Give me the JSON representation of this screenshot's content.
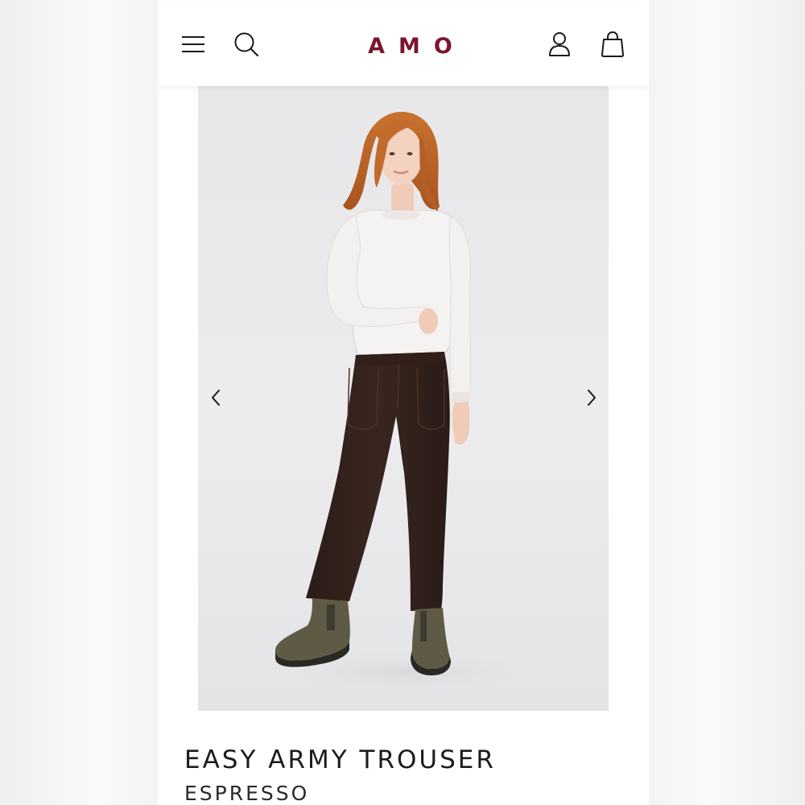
{
  "header": {
    "logo": "AMO",
    "logo_color": "#7a1530",
    "icons": {
      "menu": "hamburger-menu-icon",
      "search": "search-icon",
      "account": "account-icon",
      "cart": "shopping-bag-icon"
    }
  },
  "product": {
    "name": "EASY ARMY TROUSER",
    "color_variant": "ESPRESSO"
  },
  "gallery": {
    "prev_icon": "chevron-left-icon",
    "next_icon": "chevron-right-icon"
  }
}
